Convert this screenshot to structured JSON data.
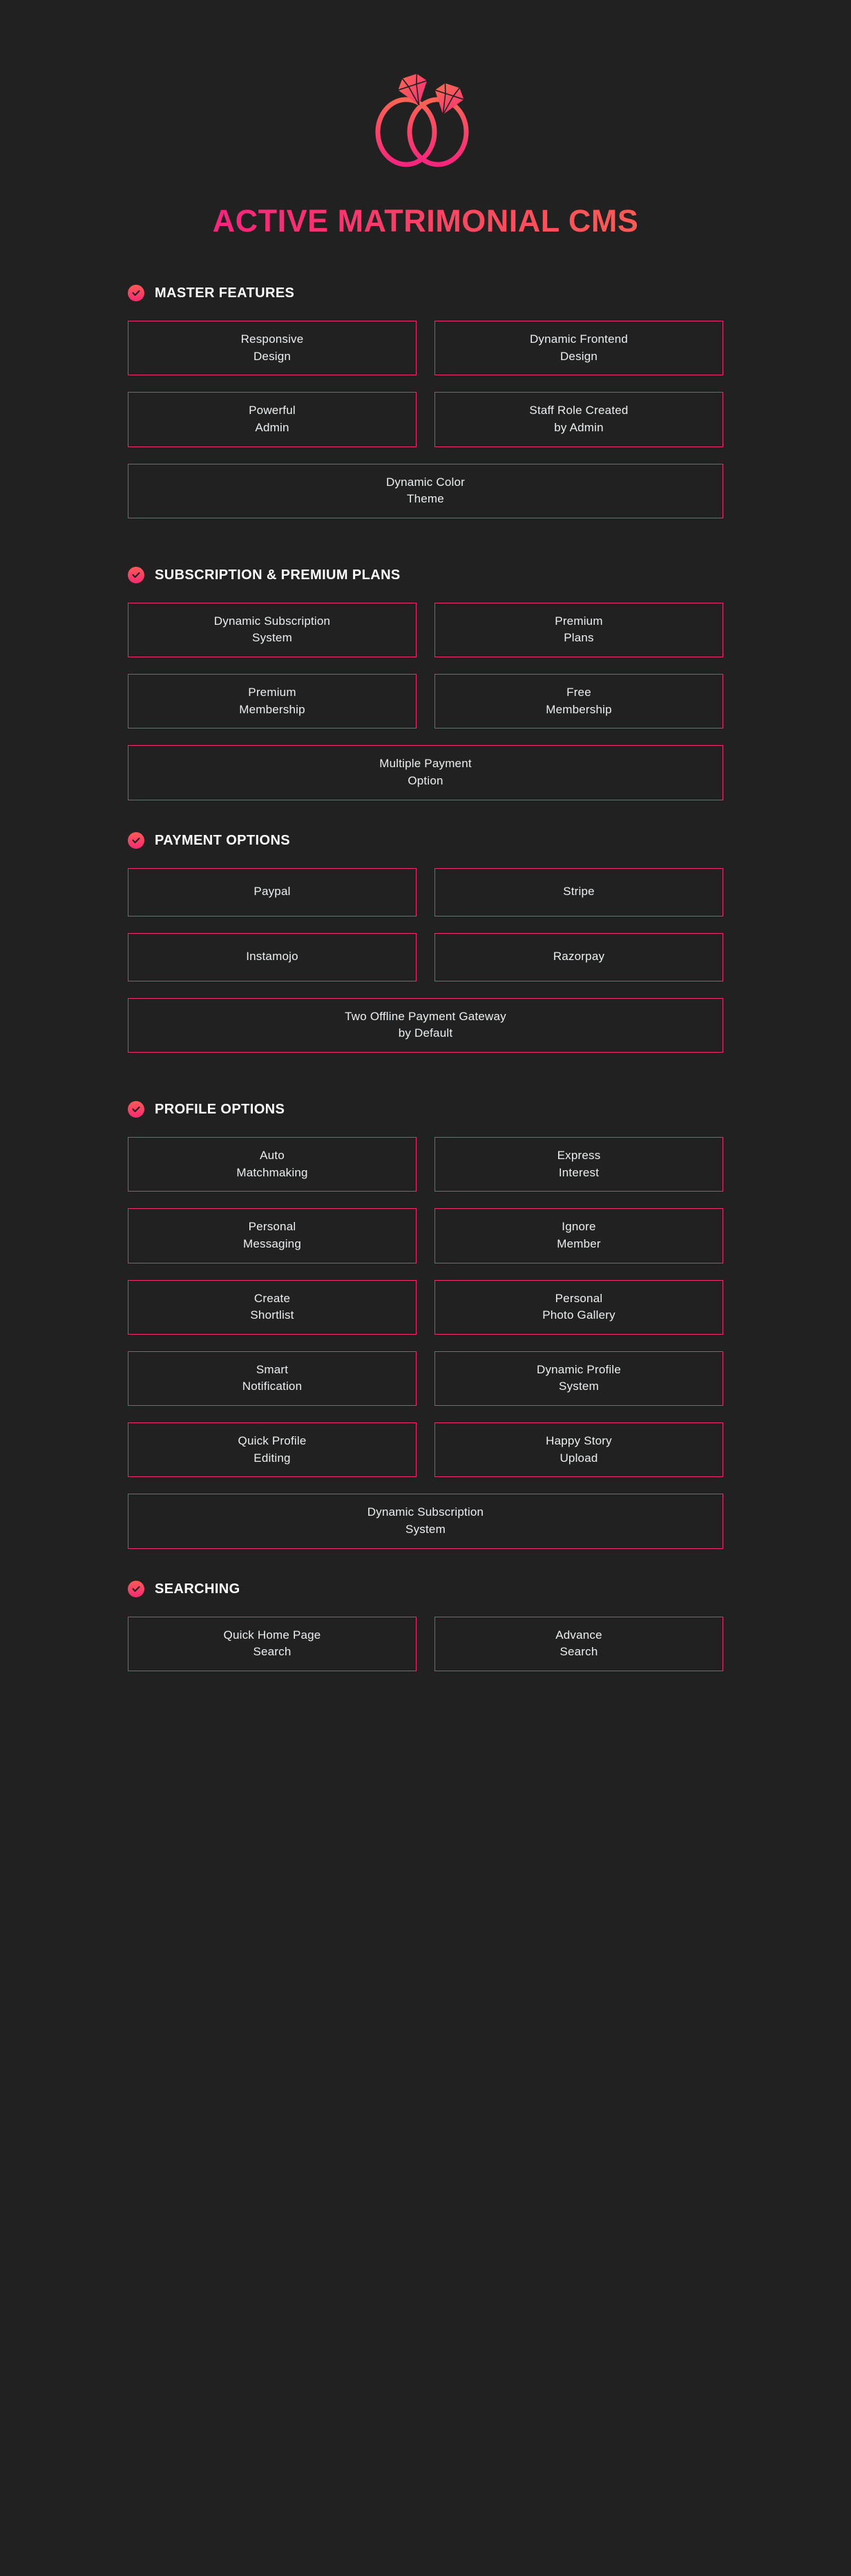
{
  "header": {
    "logo_icon": "wedding-rings-icon",
    "title": "Active Matrimonial CMS"
  },
  "colors": {
    "background": "#212121",
    "border_pink": "#ef2a72",
    "accent_pink": "#f5257e",
    "accent_coral": "#fb5a55",
    "text_light": "#eceff1",
    "heading_white": "#ffffff"
  },
  "sections": [
    {
      "icon": "check-circle-icon",
      "title": "MASTER FEATURES",
      "items": [
        {
          "lines": [
            "Responsive",
            "Design"
          ],
          "wide": false
        },
        {
          "lines": [
            "Dynamic Frontend",
            "Design"
          ],
          "wide": false
        },
        {
          "lines": [
            "Powerful",
            "Admin"
          ],
          "wide": false
        },
        {
          "lines": [
            "Staff Role Created",
            "by Admin"
          ],
          "wide": false
        },
        {
          "lines": [
            "Dynamic Color",
            "Theme"
          ],
          "wide": true
        }
      ]
    },
    {
      "icon": "check-circle-icon",
      "title": "SUBSCRIPTION & PREMIUM PLANS",
      "items": [
        {
          "lines": [
            "Dynamic Subscription",
            "System"
          ],
          "wide": false
        },
        {
          "lines": [
            "Premium",
            "Plans"
          ],
          "wide": false
        },
        {
          "lines": [
            "Premium",
            "Membership"
          ],
          "wide": false
        },
        {
          "lines": [
            "Free",
            "Membership"
          ],
          "wide": false
        },
        {
          "lines": [
            "Multiple Payment",
            "Option"
          ],
          "wide": true
        }
      ]
    },
    {
      "icon": "check-circle-icon",
      "title": "PAYMENT OPTIONS",
      "items": [
        {
          "lines": [
            "Paypal"
          ],
          "wide": false
        },
        {
          "lines": [
            "Stripe"
          ],
          "wide": false
        },
        {
          "lines": [
            "Instamojo"
          ],
          "wide": false
        },
        {
          "lines": [
            "Razorpay"
          ],
          "wide": false
        },
        {
          "lines": [
            "Two Offline Payment Gateway",
            "by Default"
          ],
          "wide": true
        }
      ]
    },
    {
      "icon": "check-circle-icon",
      "title": "PROFILE OPTIONS",
      "items": [
        {
          "lines": [
            "Auto",
            "Matchmaking"
          ],
          "wide": false
        },
        {
          "lines": [
            "Express",
            "Interest"
          ],
          "wide": false
        },
        {
          "lines": [
            "Personal",
            "Messaging"
          ],
          "wide": false
        },
        {
          "lines": [
            "Ignore",
            "Member"
          ],
          "wide": false
        },
        {
          "lines": [
            "Create",
            "Shortlist"
          ],
          "wide": false
        },
        {
          "lines": [
            "Personal",
            "Photo Gallery"
          ],
          "wide": false
        },
        {
          "lines": [
            "Smart",
            "Notification"
          ],
          "wide": false
        },
        {
          "lines": [
            "Dynamic Profile",
            "System"
          ],
          "wide": false
        },
        {
          "lines": [
            "Quick Profile",
            "Editing"
          ],
          "wide": false
        },
        {
          "lines": [
            "Happy Story",
            "Upload"
          ],
          "wide": false
        },
        {
          "lines": [
            "Dynamic Subscription",
            "System"
          ],
          "wide": true
        }
      ]
    },
    {
      "icon": "check-circle-icon",
      "title": "SEARCHING",
      "items": [
        {
          "lines": [
            "Quick Home Page",
            "Search"
          ],
          "wide": false
        },
        {
          "lines": [
            "Advance",
            "Search"
          ],
          "wide": false
        }
      ]
    }
  ]
}
